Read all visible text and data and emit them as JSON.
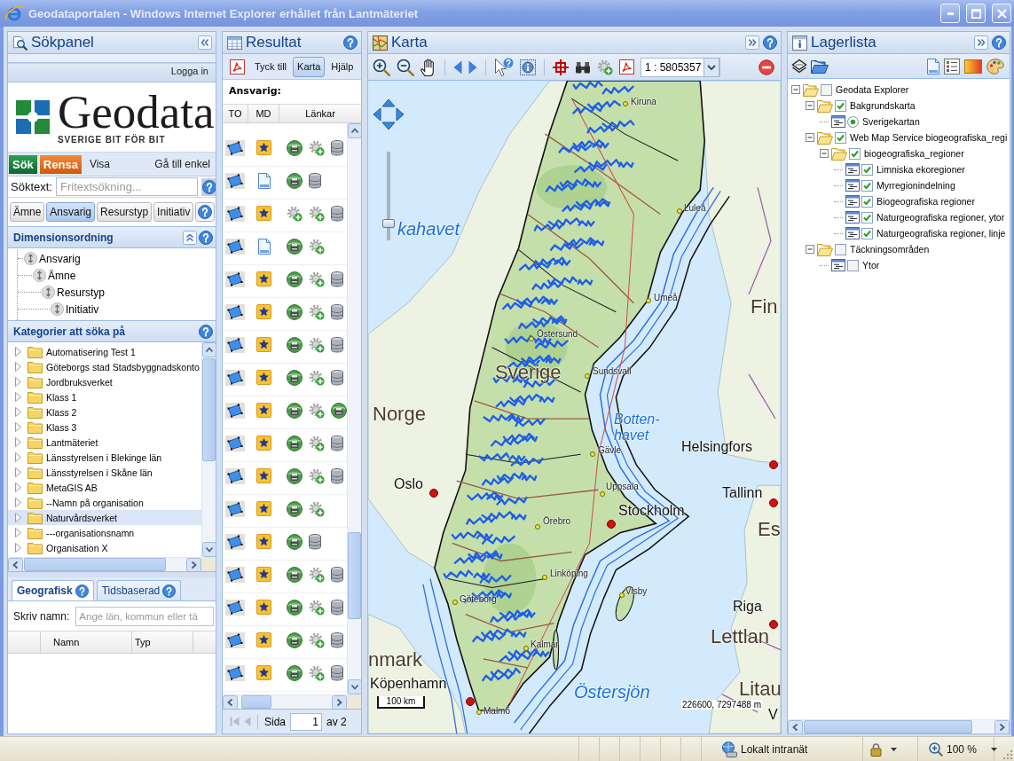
{
  "window": {
    "title": "Geodataportalen - Windows Internet Explorer erhållet från Lantmäteriet"
  },
  "search_panel": {
    "title": "Sökpanel",
    "login": "Logga in",
    "logo": {
      "wordmark": "Geodata",
      "tagline": "SVERIGE BIT FÖR BIT"
    },
    "actions": [
      {
        "label": "Sök",
        "kind": "search"
      },
      {
        "label": "Rensa",
        "kind": "clear"
      },
      {
        "label": "Visa",
        "kind": "show"
      }
    ],
    "simple_link": "Gå till enkel",
    "search_field": {
      "label": "Söktext:",
      "placeholder": "Fritextsökning..."
    },
    "tabs": [
      {
        "label": "Ämne",
        "selected": false
      },
      {
        "label": "Ansvarig",
        "selected": true
      },
      {
        "label": "Resurstyp",
        "selected": false
      },
      {
        "label": "Initiativ",
        "selected": false
      }
    ],
    "dimension_order": {
      "title": "Dimensionsordning",
      "items": [
        {
          "label": "Ansvarig",
          "children": [
            {
              "label": "Ämne",
              "children": [
                {
                  "label": "Resurstyp",
                  "children": [
                    {
                      "label": "Initiativ"
                    }
                  ]
                }
              ]
            }
          ]
        }
      ]
    },
    "categories": {
      "title": "Kategorier att söka på",
      "items": [
        {
          "label": "Automatisering Test 1",
          "expanded": false,
          "selected": false
        },
        {
          "label": "Göteborgs stad Stadsbyggnadskonto",
          "expanded": false,
          "selected": false
        },
        {
          "label": "Jordbruksverket",
          "expanded": false,
          "selected": false
        },
        {
          "label": "Klass 1",
          "expanded": false,
          "selected": false
        },
        {
          "label": "Klass 2",
          "expanded": false,
          "selected": false
        },
        {
          "label": "Klass 3",
          "expanded": false,
          "selected": false
        },
        {
          "label": "Lantmäteriet",
          "expanded": false,
          "selected": false
        },
        {
          "label": "Länsstyrelsen i Blekinge län",
          "expanded": false,
          "selected": false
        },
        {
          "label": "Länsstyrelsen i Skåne län",
          "expanded": false,
          "selected": false
        },
        {
          "label": "MetaGIS AB",
          "expanded": false,
          "selected": false
        },
        {
          "label": "--Namn på organisation",
          "expanded": false,
          "selected": false
        },
        {
          "label": "Naturvårdsverket",
          "expanded": false,
          "selected": true
        },
        {
          "label": "---organisationsnamn",
          "expanded": false,
          "selected": false
        },
        {
          "label": "Organisation X",
          "expanded": false,
          "selected": false
        }
      ]
    },
    "place_tabs": [
      {
        "label": "Geografisk",
        "selected": true
      },
      {
        "label": "Tidsbaserad",
        "selected": false
      }
    ],
    "place_field": {
      "label": "Skriv namn:",
      "placeholder": "Ange län, kommun eller tä"
    },
    "place_table": {
      "columns": [
        "Namn",
        "Typ"
      ]
    }
  },
  "results": {
    "title": "Resultat",
    "toolbar": [
      {
        "label": "Tyck till",
        "pressed": false
      },
      {
        "label": "Karta",
        "pressed": true
      },
      {
        "label": "Hjälp",
        "pressed": false
      }
    ],
    "heading": "Ansvarig:",
    "columns": [
      "TO",
      "MD",
      "Länkar"
    ],
    "rows": [
      {
        "md": {
          "kind": "star"
        },
        "links": [
          {
            "kind": "globe"
          },
          {
            "kind": "gear"
          },
          {
            "kind": "database"
          }
        ]
      },
      {
        "md": {
          "kind": "doc"
        },
        "links": [
          {
            "kind": "globe"
          },
          {
            "kind": "database"
          }
        ]
      },
      {
        "md": {
          "kind": "star"
        },
        "links": [
          {
            "kind": "gear"
          },
          {
            "kind": "gear"
          },
          {
            "kind": "database"
          }
        ]
      },
      {
        "md": {
          "kind": "doc"
        },
        "links": [
          {
            "kind": "globe"
          },
          {
            "kind": "gear"
          }
        ]
      },
      {
        "md": {
          "kind": "star"
        },
        "links": [
          {
            "kind": "globe"
          },
          {
            "kind": "gear"
          },
          {
            "kind": "database"
          }
        ]
      },
      {
        "md": {
          "kind": "star"
        },
        "links": [
          {
            "kind": "globe"
          },
          {
            "kind": "gear"
          },
          {
            "kind": "database"
          }
        ]
      },
      {
        "md": {
          "kind": "star"
        },
        "links": [
          {
            "kind": "globe"
          },
          {
            "kind": "gear"
          },
          {
            "kind": "database"
          }
        ]
      },
      {
        "md": {
          "kind": "star"
        },
        "links": [
          {
            "kind": "globe"
          },
          {
            "kind": "gear"
          },
          {
            "kind": "database"
          }
        ]
      },
      {
        "md": {
          "kind": "star"
        },
        "links": [
          {
            "kind": "globe"
          },
          {
            "kind": "gear"
          },
          {
            "kind": "globe"
          }
        ]
      },
      {
        "md": {
          "kind": "star"
        },
        "links": [
          {
            "kind": "globe"
          },
          {
            "kind": "gear"
          },
          {
            "kind": "database"
          }
        ]
      },
      {
        "md": {
          "kind": "star"
        },
        "links": [
          {
            "kind": "globe"
          },
          {
            "kind": "gear"
          },
          {
            "kind": "database"
          }
        ]
      },
      {
        "md": {
          "kind": "star"
        },
        "links": [
          {
            "kind": "globe"
          },
          {
            "kind": "gear"
          }
        ]
      },
      {
        "md": {
          "kind": "star"
        },
        "links": [
          {
            "kind": "globe"
          },
          {
            "kind": "database"
          }
        ]
      },
      {
        "md": {
          "kind": "star"
        },
        "links": [
          {
            "kind": "globe"
          },
          {
            "kind": "gear"
          },
          {
            "kind": "database"
          }
        ]
      },
      {
        "md": {
          "kind": "star"
        },
        "links": [
          {
            "kind": "globe"
          },
          {
            "kind": "gear"
          },
          {
            "kind": "database"
          }
        ]
      },
      {
        "md": {
          "kind": "star"
        },
        "links": [
          {
            "kind": "globe"
          },
          {
            "kind": "gear"
          },
          {
            "kind": "database"
          }
        ]
      },
      {
        "md": {
          "kind": "star"
        },
        "links": [
          {
            "kind": "globe"
          },
          {
            "kind": "gear"
          },
          {
            "kind": "database"
          }
        ]
      }
    ],
    "pager": {
      "buttons": [
        {
          "kind": "first",
          "disabled": true
        },
        {
          "kind": "previous",
          "disabled": true
        }
      ],
      "label": "Sida",
      "value": "1",
      "total": "av 2"
    }
  },
  "map": {
    "title": "Karta",
    "tools": [
      {
        "kind": "zoomin"
      },
      {
        "kind": "zoomout"
      },
      {
        "kind": "pan"
      },
      {
        "kind": "separator"
      },
      {
        "kind": "back"
      },
      {
        "kind": "forward"
      },
      {
        "kind": "separator"
      },
      {
        "kind": "identify"
      },
      {
        "kind": "info"
      },
      {
        "kind": "separator"
      },
      {
        "kind": "crosshair"
      },
      {
        "kind": "binoculars"
      },
      {
        "kind": "add"
      },
      {
        "kind": "pdf"
      }
    ],
    "scale": "1 : 5805357",
    "end_tools": [
      {
        "kind": "remove"
      }
    ],
    "zoom_slider": {
      "level": 0.15
    },
    "labels": [
      {
        "text": "kahavet",
        "kind": "sea"
      },
      {
        "text": "Fin",
        "kind": "country"
      },
      {
        "text": "Norge",
        "kind": "country"
      },
      {
        "text": "Sverige",
        "kind": "country"
      },
      {
        "text": "Botten-havet",
        "kind": "sea"
      },
      {
        "text": "Helsingfors",
        "kind": "capital"
      },
      {
        "text": "Oslo",
        "kind": "capital"
      },
      {
        "text": "Tallinn",
        "kind": "capital"
      },
      {
        "text": "Es",
        "kind": "country"
      },
      {
        "text": "Stockholm",
        "kind": "capital"
      },
      {
        "text": "Riga",
        "kind": "capital"
      },
      {
        "text": "Lettlan",
        "kind": "country"
      },
      {
        "text": "nmark",
        "kind": "country"
      },
      {
        "text": "Köpenhamn",
        "kind": "capital"
      },
      {
        "text": "Östersjön",
        "kind": "sea"
      },
      {
        "text": "Litau",
        "kind": "country"
      },
      {
        "text": "V",
        "kind": "city"
      },
      {
        "text": "Kiruna",
        "kind": "town"
      },
      {
        "text": "Luleå",
        "kind": "town"
      },
      {
        "text": "Umeå",
        "kind": "town"
      },
      {
        "text": "Östersund",
        "kind": "town"
      },
      {
        "text": "Sundsvall",
        "kind": "town"
      },
      {
        "text": "Gävle",
        "kind": "town"
      },
      {
        "text": "Uppsala",
        "kind": "town"
      },
      {
        "text": "Örebro",
        "kind": "town"
      },
      {
        "text": "Linköping",
        "kind": "town"
      },
      {
        "text": "Göteborg",
        "kind": "town"
      },
      {
        "text": "Visby",
        "kind": "town"
      },
      {
        "text": "Kalmar",
        "kind": "town"
      },
      {
        "text": "Malmö",
        "kind": "town"
      }
    ],
    "scale_bar": "100 km",
    "coordinates": "226600, 7297488 m"
  },
  "layers": {
    "title": "Lagerlista",
    "tools": [
      {
        "kind": "layers"
      },
      {
        "kind": "folder"
      }
    ],
    "end_tools": [
      {
        "kind": "document"
      },
      {
        "kind": "legend"
      },
      {
        "kind": "gradient"
      },
      {
        "kind": "palette"
      }
    ],
    "tree": [
      {
        "label": "Geodata Explorer",
        "kind": "folder",
        "expanded": true,
        "checked": false,
        "children": [
          {
            "label": "Bakgrundskarta",
            "kind": "folder",
            "expanded": true,
            "checked": true,
            "children": [
              {
                "label": "Sverigekartan",
                "kind": "radio",
                "checked": true
              }
            ]
          },
          {
            "label": "Web Map Service biogeografiska_regi",
            "kind": "folder",
            "expanded": true,
            "checked": true,
            "children": [
              {
                "label": "biogeografiska_regioner",
                "kind": "folder",
                "expanded": true,
                "checked": true,
                "children": [
                  {
                    "label": "Limniska ekoregioner",
                    "kind": "layer",
                    "checked": true
                  },
                  {
                    "label": "Myrregionindelning",
                    "kind": "layer",
                    "checked": true
                  },
                  {
                    "label": "Biogeografiska regioner",
                    "kind": "layer",
                    "checked": true
                  },
                  {
                    "label": "Naturgeografiska regioner, ytor",
                    "kind": "layer",
                    "checked": true
                  },
                  {
                    "label": "Naturgeografiska regioner, linje",
                    "kind": "layer",
                    "checked": true
                  }
                ]
              }
            ]
          },
          {
            "label": "Täckningsområden",
            "kind": "folder",
            "expanded": true,
            "checked": false,
            "children": [
              {
                "label": "Ytor",
                "kind": "layer",
                "checked": false
              }
            ]
          }
        ]
      }
    ]
  },
  "status_bar": {
    "zone": "Lokalt intranät",
    "zoom": "100 %"
  }
}
